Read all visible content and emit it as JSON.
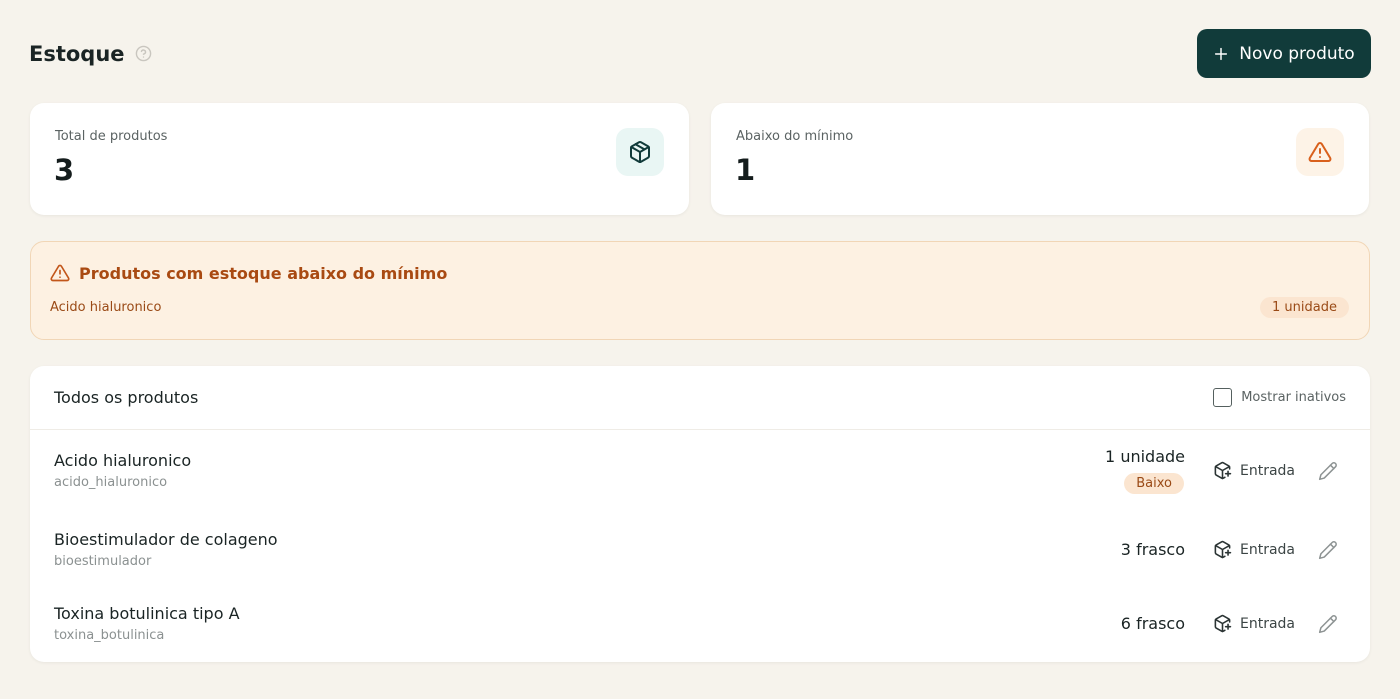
{
  "header": {
    "title": "Estoque",
    "new_button_label": "Novo produto"
  },
  "stats": [
    {
      "label": "Total de produtos",
      "value": "3",
      "icon": "package-icon",
      "accent": "#113b3a"
    },
    {
      "label": "Abaixo do mínimo",
      "value": "1",
      "icon": "warning-icon",
      "accent": "#d9601c"
    }
  ],
  "alert": {
    "title": "Produtos com estoque abaixo do mínimo",
    "items": [
      {
        "name": "Acido hialuronico",
        "quantity": "1 unidade"
      }
    ]
  },
  "list": {
    "title": "Todos os produtos",
    "show_inactive_label": "Mostrar inativos",
    "show_inactive_checked": false,
    "entry_label": "Entrada",
    "rows": [
      {
        "name": "Acido hialuronico",
        "slug": "acido_hialuronico",
        "quantity": "1 unidade",
        "badge": "Baixo"
      },
      {
        "name": "Bioestimulador de colageno",
        "slug": "bioestimulador",
        "quantity": "3 frasco"
      },
      {
        "name": "Toxina botulinica tipo A",
        "slug": "toxina_botulinica",
        "quantity": "6 frasco"
      }
    ]
  },
  "colors": {
    "background": "#f6f3ec",
    "primary": "#113b3a",
    "warning": "#a94a12",
    "warning_bg": "#fdf1e2"
  }
}
